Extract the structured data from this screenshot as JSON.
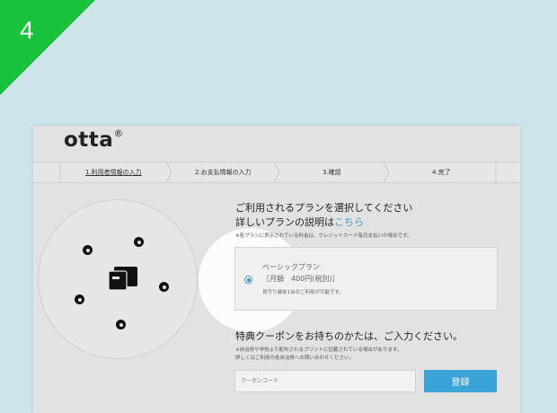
{
  "step_badge": {
    "number": "4",
    "color": "#19c23c"
  },
  "header": {
    "logo": "otta",
    "logo_mark": "®"
  },
  "steps": [
    {
      "label": "1.利用者情報の入力",
      "active": true
    },
    {
      "label": "2.お支払情報の入力",
      "active": false
    },
    {
      "label": "3.確認",
      "active": false
    },
    {
      "label": "4.完了",
      "active": false
    }
  ],
  "plan_section": {
    "title": "ご利用されるプランを選択してください",
    "subtitle_prefix": "詳しいプランの説明は",
    "subtitle_link": "こちら",
    "note": "※各プランに表示されている料金は、クレジットカード毎月支払いの場合です。",
    "plan": {
      "name": "ベーシックプラン",
      "price": "［月額　400円(税別)］",
      "note": "見守り端末1台のご利用が可能です。",
      "selected": true
    }
  },
  "coupon_section": {
    "title": "特典クーポンをお持ちのかたは、ご入力ください。",
    "note_1": "※自治体や学校より配布されるプリントに記載されている場合があります。",
    "note_2": "詳しくはご利用の各自治体へお問い合わせください。",
    "input_placeholder": "クーポンコード",
    "submit_label": "登録"
  },
  "colors": {
    "background": "#cde4ea",
    "accent_button": "#3aa4d8",
    "link": "#4a9cc8",
    "radio": "#3a8fd0"
  },
  "icons": [
    "card-stack-icon",
    "beacon-dot-icon",
    "radio-selected-icon"
  ]
}
